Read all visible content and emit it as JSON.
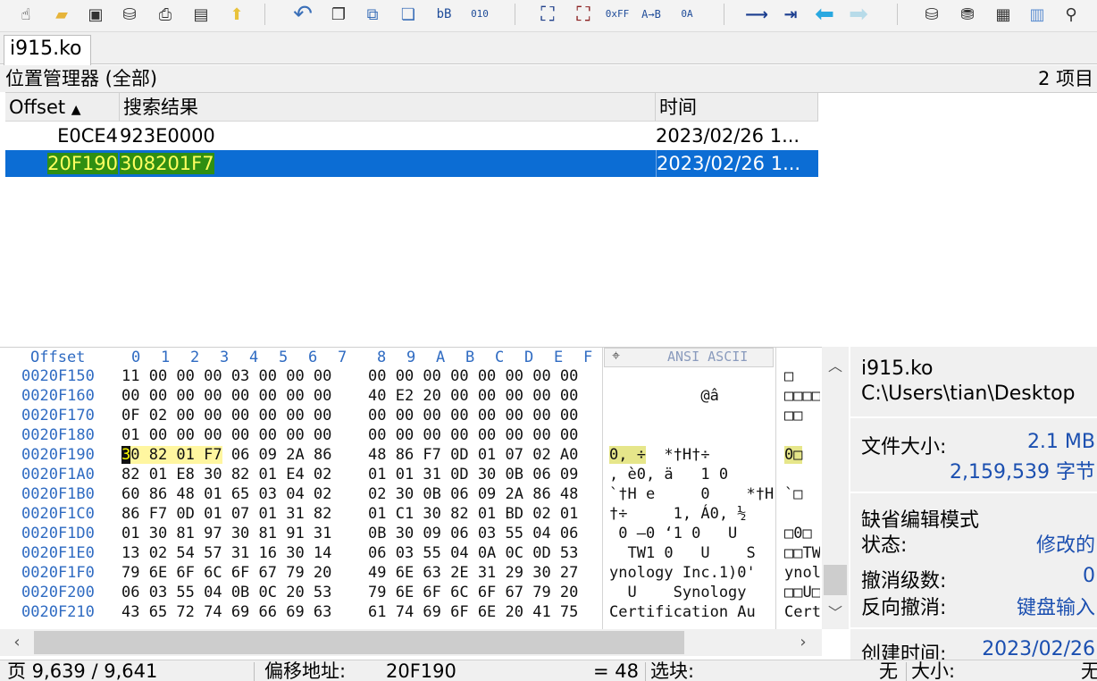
{
  "toolbar": {
    "icons": [
      "new-file-icon",
      "open-folder-icon",
      "save-icon",
      "save-disk-icon",
      "print-icon",
      "properties-icon",
      "export-icon",
      "undo-icon",
      "copy-icon",
      "paste-icon",
      "paste-special-icon",
      "convert-icon",
      "binary-icon",
      "find-icon",
      "find-hex-icon",
      "replace-icon",
      "replace-hex-icon",
      "goto-offset-icon",
      "goto-next-icon",
      "back-icon",
      "forward-icon",
      "open-disk-icon",
      "disk-add-icon",
      "memory-icon",
      "calculator-icon",
      "search-magnifier-icon"
    ],
    "find_hex_label": "0xFF",
    "replace_label": "A→B",
    "replace_hex_label": "0A",
    "convert_label": "bB",
    "binary_label": "010"
  },
  "tab": {
    "title": "i915.ko"
  },
  "position_manager": {
    "header": "位置管理器 (全部)",
    "count": "2 项目",
    "columns": [
      "Offset",
      "搜索结果",
      "时间"
    ],
    "rows": [
      {
        "offset": "E0CE4",
        "result": "923E0000",
        "time": "2023/02/26   1...",
        "selected": false
      },
      {
        "offset": "20F190",
        "result": "308201F7",
        "time": "2023/02/26   1...",
        "selected": true
      }
    ]
  },
  "hex": {
    "offset_label": "Offset",
    "column_labels": [
      "0",
      "1",
      "2",
      "3",
      "4",
      "5",
      "6",
      "7",
      "8",
      "9",
      "A",
      "B",
      "C",
      "D",
      "E",
      "F"
    ],
    "ansi_label": "ANSI ASCII",
    "rows": [
      {
        "addr": "0020F150",
        "b1": "11 00 00 00 03 00 00 00",
        "b2": "00 00 00 00 00 00 00 00",
        "ascii": "",
        "ascii2": "□"
      },
      {
        "addr": "0020F160",
        "b1": "00 00 00 00 00 00 00 00",
        "b2": "40 E2 20 00 00 00 00 00",
        "ascii": "          @â",
        "ascii2": "□□□□"
      },
      {
        "addr": "0020F170",
        "b1": "0F 02 00 00 00 00 00 00",
        "b2": "00 00 00 00 00 00 00 00",
        "ascii": "",
        "ascii2": "□□"
      },
      {
        "addr": "0020F180",
        "b1": "01 00 00 00 00 00 00 00",
        "b2": "00 00 00 00 00 00 00 00",
        "ascii": "",
        "ascii2": ""
      },
      {
        "addr": "0020F190",
        "b1": "30 82 01 F7 06 09 2A 86",
        "b2": "48 86 F7 0D 01 07 02 A0",
        "ascii": "0‚ ÷  *†H†÷",
        "ascii2": "0□"
      },
      {
        "addr": "0020F1A0",
        "b1": "82 01 E8 30 82 01 E4 02",
        "b2": "01 01 31 0D 30 0B 06 09",
        "ascii": ", è0, ä   1 0",
        "ascii2": "    ("
      },
      {
        "addr": "0020F1B0",
        "b1": "60 86 48 01 65 03 04 02",
        "b2": "02 30 0B 06 09 2A 86 48",
        "ascii": "`†H e     0    *†H",
        "ascii2": "`□"
      },
      {
        "addr": "0020F1C0",
        "b1": "86 F7 0D 01 07 01 31 82",
        "b2": "01 C1 30 82 01 BD 02 01",
        "ascii": "†÷     1, Á0, ½",
        "ascii2": "    ["
      },
      {
        "addr": "0020F1D0",
        "b1": "01 30 81 97 30 81 91 31",
        "b2": "0B 30 09 06 03 55 04 06",
        "ascii": " 0 —0 ‘1 0   U",
        "ascii2": "□0□"
      },
      {
        "addr": "0020F1E0",
        "b1": "13 02 54 57 31 16 30 14",
        "b2": "06 03 55 04 0A 0C 0D 53",
        "ascii": "  TW1 0   U    S",
        "ascii2": "□□TW"
      },
      {
        "addr": "0020F1F0",
        "b1": "79 6E 6F 6C 6F 67 79 20",
        "b2": "49 6E 63 2E 31 29 30 27",
        "ascii": "ynology Inc.1)0'",
        "ascii2": "ynol"
      },
      {
        "addr": "0020F200",
        "b1": "06 03 55 04 0B 0C 20 53",
        "b2": "79 6E 6F 6C 6F 67 79 20",
        "ascii": "  U    Synology",
        "ascii2": "□□U□"
      },
      {
        "addr": "0020F210",
        "b1": "43 65 72 74 69 66 69 63",
        "b2": "61 74 69 6F 6E 20 41 75",
        "ascii": "Certification Au",
        "ascii2": "Cert"
      }
    ]
  },
  "info": {
    "filename": "i915.ko",
    "path": "C:\\Users\\tian\\Desktop",
    "size_label": "文件大小:",
    "size_mb": "2.1 MB",
    "size_bytes": "2,159,539 字节",
    "edit_mode": "缺省编辑模式",
    "state_label": "状态:",
    "state_value": "修改的",
    "undo_label": "撤消级数:",
    "undo_value": "0",
    "redo_label": "反向撤消:",
    "redo_value": "键盘输入",
    "created_label": "创建时间:",
    "created_value": "2023/02/26"
  },
  "status": {
    "page": "页 9,639 / 9,641",
    "offset_label": "偏移地址:",
    "offset_value": "20F190",
    "value": "= 48",
    "block_label": "选块:",
    "block_value": "无",
    "size_label": "大小:",
    "size_value": "无"
  }
}
